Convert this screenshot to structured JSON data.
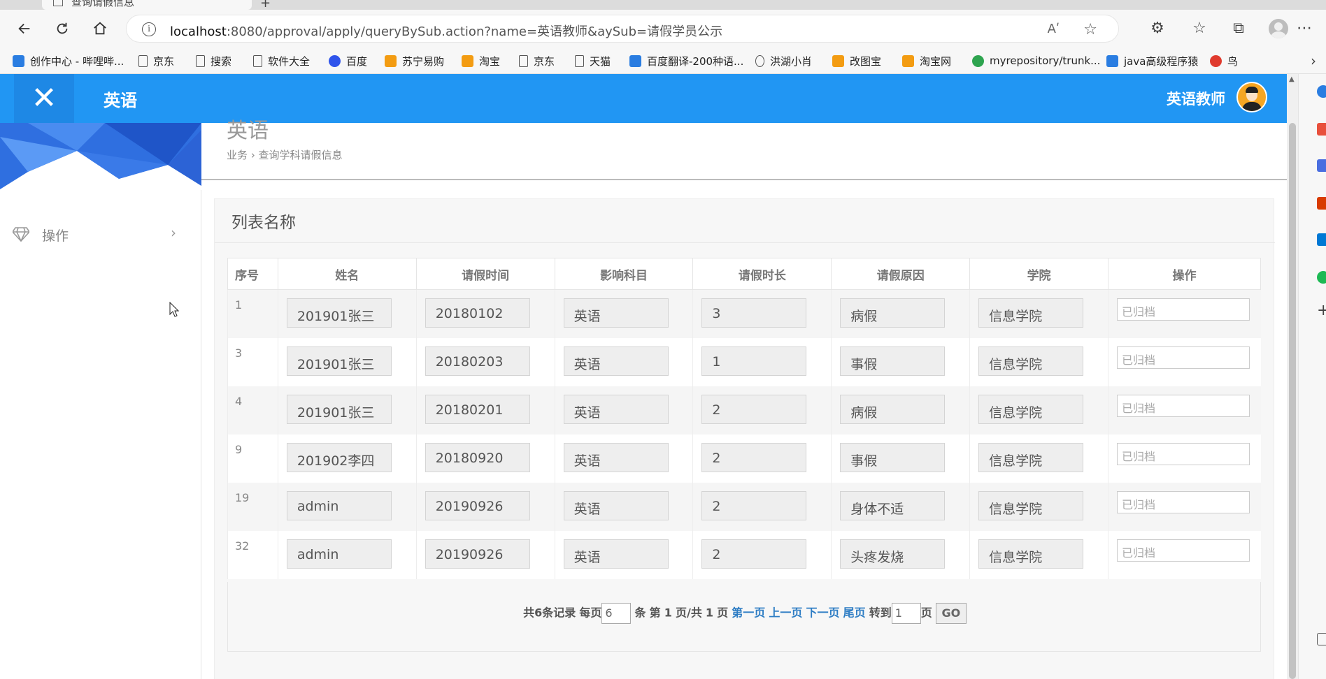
{
  "browser": {
    "tab_title": "查询请假信息",
    "url_host": "localhost",
    "url_rest": ":8080/approval/apply/queryBySub.action?name=英语教师&aySub=请假学员公示",
    "read_aloud": "Aʹ",
    "bookmarks": [
      {
        "label": "创作中心 - 哔哩哔...",
        "icon": "bilibili-icon"
      },
      {
        "label": "京东",
        "icon": "page-icon"
      },
      {
        "label": "搜索",
        "icon": "page-icon"
      },
      {
        "label": "软件大全",
        "icon": "page-icon"
      },
      {
        "label": "百度",
        "icon": "baidu-paw-icon"
      },
      {
        "label": "苏宁易购",
        "icon": "suning-icon"
      },
      {
        "label": "淘宝",
        "icon": "taobao-icon"
      },
      {
        "label": "京东",
        "icon": "page-icon"
      },
      {
        "label": "天猫",
        "icon": "page-icon"
      },
      {
        "label": "百度翻译-200种语...",
        "icon": "translate-icon"
      },
      {
        "label": "洪湖小肖",
        "icon": "bird-icon"
      },
      {
        "label": "改图宝",
        "icon": "gaitubao-icon"
      },
      {
        "label": "淘宝网",
        "icon": "taobao-icon"
      },
      {
        "label": "myrepository/trunk...",
        "icon": "chrome-icon"
      },
      {
        "label": "java高级程序猿",
        "icon": "bilibili-icon"
      },
      {
        "label": "鸟",
        "icon": "bird-red-icon"
      }
    ]
  },
  "app": {
    "brand": "英语",
    "user_name": "英语教师",
    "sidebar_menu": "操作",
    "page_title": "英语",
    "breadcrumb": "业务 › 查询学科请假信息",
    "panel_title": "列表名称",
    "columns": [
      "序号",
      "姓名",
      "请假时间",
      "影响科目",
      "请假时长",
      "请假原因",
      "学院",
      "操作"
    ],
    "rows": [
      {
        "id": "1",
        "name": "201901张三",
        "date": "20180102",
        "subject": "英语",
        "duration": "3",
        "reason": "病假",
        "college": "信息学院",
        "op": "已归档"
      },
      {
        "id": "3",
        "name": "201901张三",
        "date": "20180203",
        "subject": "英语",
        "duration": "1",
        "reason": "事假",
        "college": "信息学院",
        "op": "已归档"
      },
      {
        "id": "4",
        "name": "201901张三",
        "date": "20180201",
        "subject": "英语",
        "duration": "2",
        "reason": "病假",
        "college": "信息学院",
        "op": "已归档"
      },
      {
        "id": "9",
        "name": "201902李四",
        "date": "20180920",
        "subject": "英语",
        "duration": "2",
        "reason": "事假",
        "college": "信息学院",
        "op": "已归档"
      },
      {
        "id": "19",
        "name": "admin",
        "date": "20190926",
        "subject": "英语",
        "duration": "2",
        "reason": "身体不适",
        "college": "信息学院",
        "op": "已归档"
      },
      {
        "id": "32",
        "name": "admin",
        "date": "20190926",
        "subject": "英语",
        "duration": "2",
        "reason": "头疼发烧",
        "college": "信息学院",
        "op": "已归档"
      }
    ],
    "pager": {
      "total": "共6条记录",
      "per_page_label": "每页",
      "per_page_value": "6",
      "per_page_unit": "条",
      "page_label": "第",
      "current_page": "1",
      "page_sep": "页/共",
      "total_pages": "1",
      "page_unit": "页",
      "first": "第一页",
      "prev": "上一页",
      "next": "下一页",
      "last": "尾页",
      "goto_label": "转到",
      "goto_value": "1",
      "goto_unit": "页",
      "go": "GO"
    }
  },
  "colors": {
    "header_blue": "#2196f3",
    "link_blue": "#2e7dc4"
  }
}
